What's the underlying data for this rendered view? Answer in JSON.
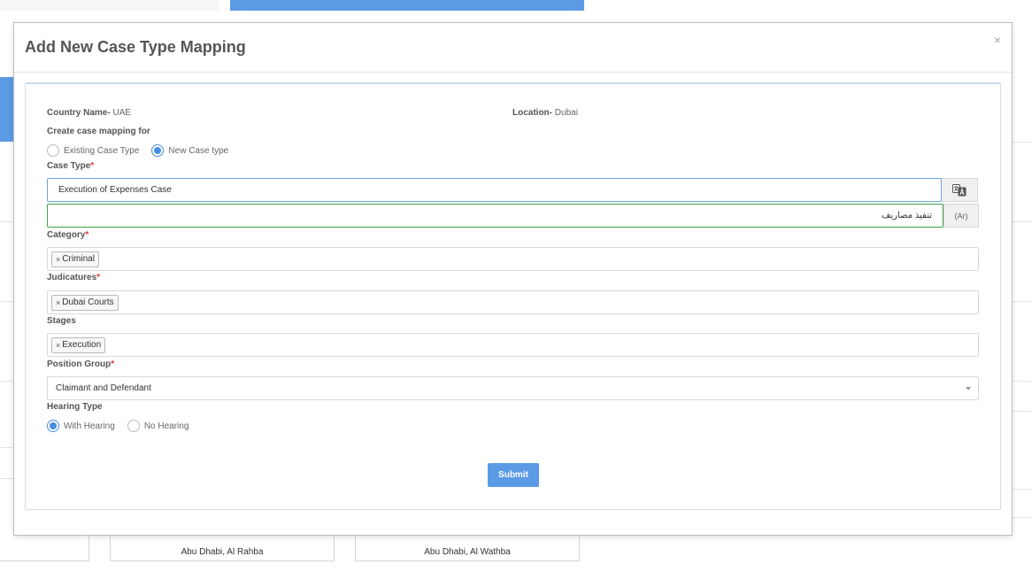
{
  "modal": {
    "title": "Add New Case Type Mapping",
    "close_glyph": "×"
  },
  "country": {
    "label": "Country Name-",
    "value": "UAE"
  },
  "location": {
    "label": "Location-",
    "value": "Dubai"
  },
  "mapping": {
    "label": "Create case mapping for",
    "options": [
      {
        "label": "Existing Case Type",
        "selected": false
      },
      {
        "label": "New Case type",
        "selected": true
      }
    ]
  },
  "case_type": {
    "label": "Case Type",
    "required_mark": "*",
    "value_en": "Execution of Expenses Case",
    "value_ar": "تنفيذ مصاريف",
    "ar_addon": "(Ar)",
    "translate_icon": "translate-icon"
  },
  "category": {
    "label": "Category",
    "required_mark": "*",
    "tags": [
      "Criminal"
    ]
  },
  "judicatures": {
    "label": "Judicatures",
    "required_mark": "*",
    "tags": [
      "Dubai Courts"
    ]
  },
  "stages": {
    "label": "Stages",
    "tags": [
      "Execution"
    ]
  },
  "position_group": {
    "label": "Position Group",
    "required_mark": "*",
    "value": "Claimant and Defendant"
  },
  "hearing_type": {
    "label": "Hearing Type",
    "options": [
      {
        "label": "With Hearing",
        "selected": true
      },
      {
        "label": "No Hearing",
        "selected": false
      }
    ]
  },
  "submit_label": "Submit",
  "tag_remove_glyph": "×",
  "background": {
    "cards": [
      "Abu Dhabi, Al Rahba",
      "Abu Dhabi, Al Wathba"
    ]
  },
  "colors": {
    "accent": "#5b9be6",
    "required": "#e53935",
    "valid_border": "#43a047"
  }
}
